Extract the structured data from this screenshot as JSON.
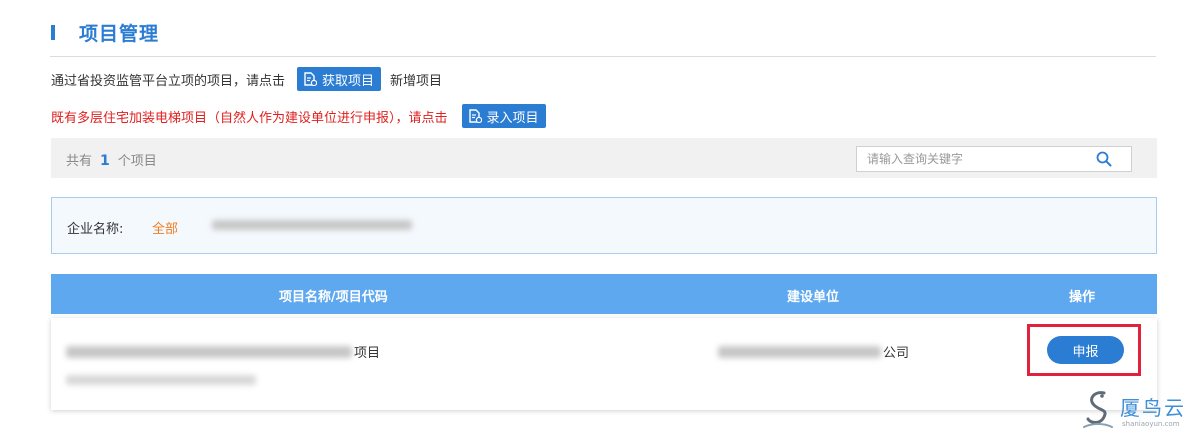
{
  "page": {
    "title": "项目管理"
  },
  "intro": {
    "line1_text": "通过省投资监管平台立项的项目，请点击",
    "fetch_button": "获取项目",
    "line1_suffix": "新增项目",
    "line2_text": "既有多层住宅加装电梯项目（自然人作为建设单位进行申报），请点击",
    "enter_button": "录入项目"
  },
  "summary": {
    "prefix": "共有",
    "count": "1",
    "suffix": "个项目",
    "search_placeholder": "请输入查询关键字"
  },
  "filter": {
    "label": "企业名称:",
    "all_option": "全部"
  },
  "table": {
    "columns": [
      "项目名称/项目代码",
      "建设单位",
      "操作"
    ],
    "rows": [
      {
        "name_suffix": "项目",
        "unit_suffix": "公司",
        "action": "申报"
      }
    ]
  },
  "watermark": {
    "brand": "厦鸟云",
    "site": "shaniaoyun.com"
  },
  "colors": {
    "primary": "#2b7cd3",
    "table_header": "#5ea8ef",
    "warning_text": "#e02020",
    "filter_all": "#f07d22",
    "highlight": "#e0223d"
  }
}
